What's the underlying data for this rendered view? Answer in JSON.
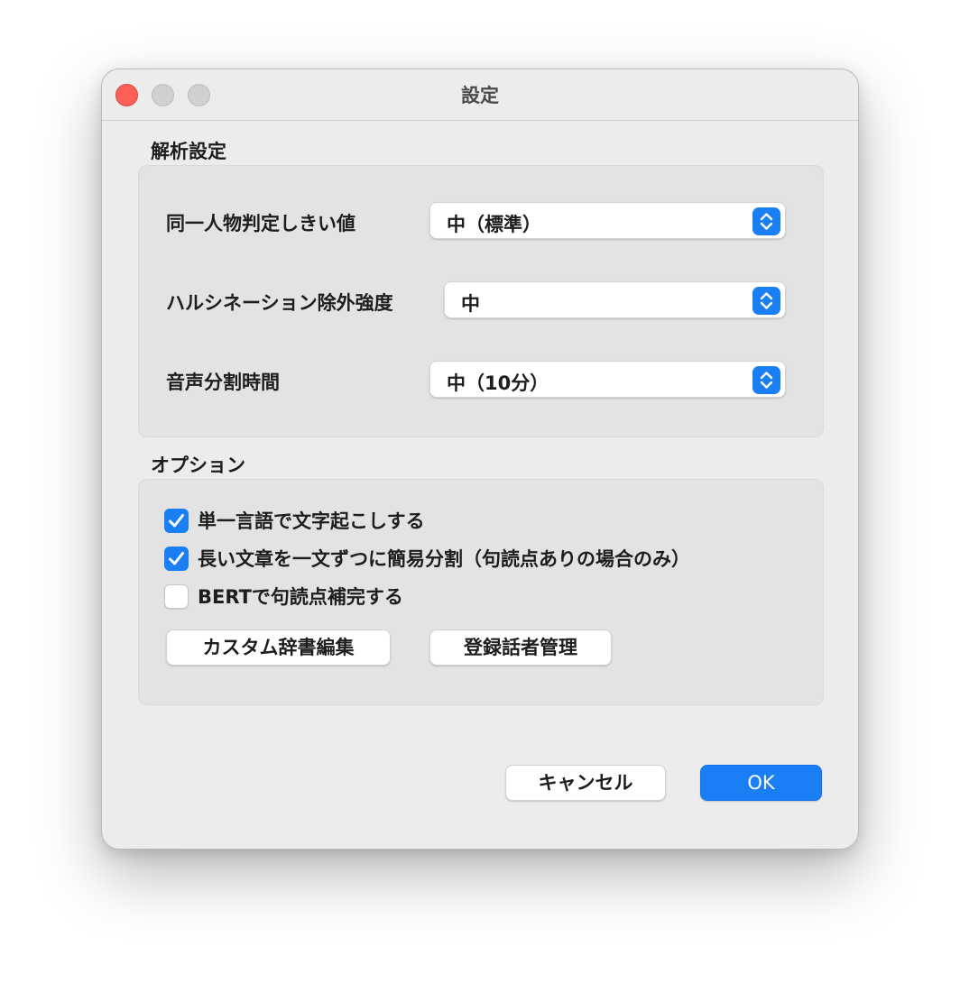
{
  "window": {
    "title": "設定"
  },
  "analysis": {
    "title": "解析設定",
    "rows": [
      {
        "label": "同一人物判定しきい値",
        "value": "中（標準）"
      },
      {
        "label": "ハルシネーション除外強度",
        "value": "中"
      },
      {
        "label": "音声分割時間",
        "value": "中（10分）"
      }
    ]
  },
  "options": {
    "title": "オプション",
    "checkboxes": [
      {
        "label": "単一言語で文字起こしする",
        "checked": true
      },
      {
        "label": "長い文章を一文ずつに簡易分割（句読点ありの場合のみ）",
        "checked": true
      },
      {
        "label": "BERTで句読点補完する",
        "checked": false
      }
    ],
    "buttons": {
      "dictionary": "カスタム辞書編集",
      "speakers": "登録話者管理"
    }
  },
  "footer": {
    "cancel": "キャンセル",
    "ok": "OK"
  },
  "colors": {
    "accent": "#1a7ff5",
    "close": "#fe5f57",
    "window_bg": "#ececec"
  }
}
